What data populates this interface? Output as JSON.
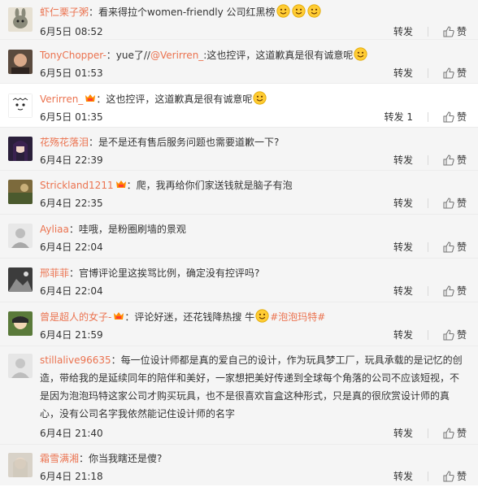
{
  "actions": {
    "repost": "转发",
    "like": "赞"
  },
  "comments": [
    {
      "user": "虾仁栗子粥",
      "sep": "：",
      "text": "看来得拉个women-friendly 公司红黑榜",
      "emoji_count": 3,
      "date": "6月5日",
      "time": "08:52",
      "repost": "转发",
      "like": "赞"
    },
    {
      "user": "TonyChopper-",
      "sep": "：",
      "text_prefix": "yue了//",
      "mention": "@Verirren_",
      "text_suffix": ":这也控评，这道歉真是很有诚意呢",
      "date": "6月5日",
      "time": "01:53",
      "repost": "转发",
      "like": "赞"
    },
    {
      "user": "Verirren_",
      "sep": "：",
      "text": "这也控评，这道歉真是很有诚意呢",
      "date": "6月5日",
      "time": "01:35",
      "repost": "转发 1",
      "like": "赞"
    },
    {
      "user": "花殇花落泪",
      "sep": "：",
      "text": "是不是还有售后服务问题也需要道歉一下?",
      "date": "6月4日",
      "time": "22:39",
      "repost": "转发",
      "like": "赞"
    },
    {
      "user": "Strickland1211",
      "sep": "：",
      "text": "爬，我再给你们家送钱就是脑子有泡",
      "date": "6月4日",
      "time": "22:35",
      "repost": "转发",
      "like": "赞"
    },
    {
      "user": "Ayliaa",
      "sep": "：",
      "text": "哇哦，是粉圈刷墙的景观",
      "date": "6月4日",
      "time": "22:04",
      "repost": "转发",
      "like": "赞"
    },
    {
      "user": "邢菲菲",
      "sep": "：",
      "text": "官博评论里这挨骂比例，确定没有控评吗?",
      "date": "6月4日",
      "time": "22:04",
      "repost": "转发",
      "like": "赞"
    },
    {
      "user": "曾是超人的女子-",
      "sep": "：",
      "text": "评论好迷，还花钱降热搜 牛",
      "tag": "#泡泡玛特#",
      "date": "6月4日",
      "time": "21:59",
      "repost": "转发",
      "like": "赞"
    },
    {
      "user": "stillalive96635",
      "sep": "：",
      "line1": "每一位设计师都是真的爱自己的设计，作为玩具梦工厂，玩具承载的是记忆的创",
      "line2": "造，带给我的是延续同年的陪伴和美好，一家想把美好传递到全球每个角落的公司不应该短视，不",
      "line3": "是因为泡泡玛特这家公司才购买玩具，也不是很喜欢盲盒这种形式，只是真的很欣赏设计师的真",
      "line4": "心，没有公司名字我依然能记住设计师的名字",
      "date": "6月4日",
      "time": "21:40",
      "repost": "转发",
      "like": "赞"
    },
    {
      "user": "霜雪满湘",
      "sep": "：",
      "text": "你当我瞎还是傻?",
      "date": "6月4日",
      "time": "21:18",
      "repost": "转发",
      "like": "赞"
    }
  ],
  "colors": {
    "username": "#eb7350",
    "text": "#333333",
    "divider": "#ececec",
    "background": "#f5f5f5"
  }
}
